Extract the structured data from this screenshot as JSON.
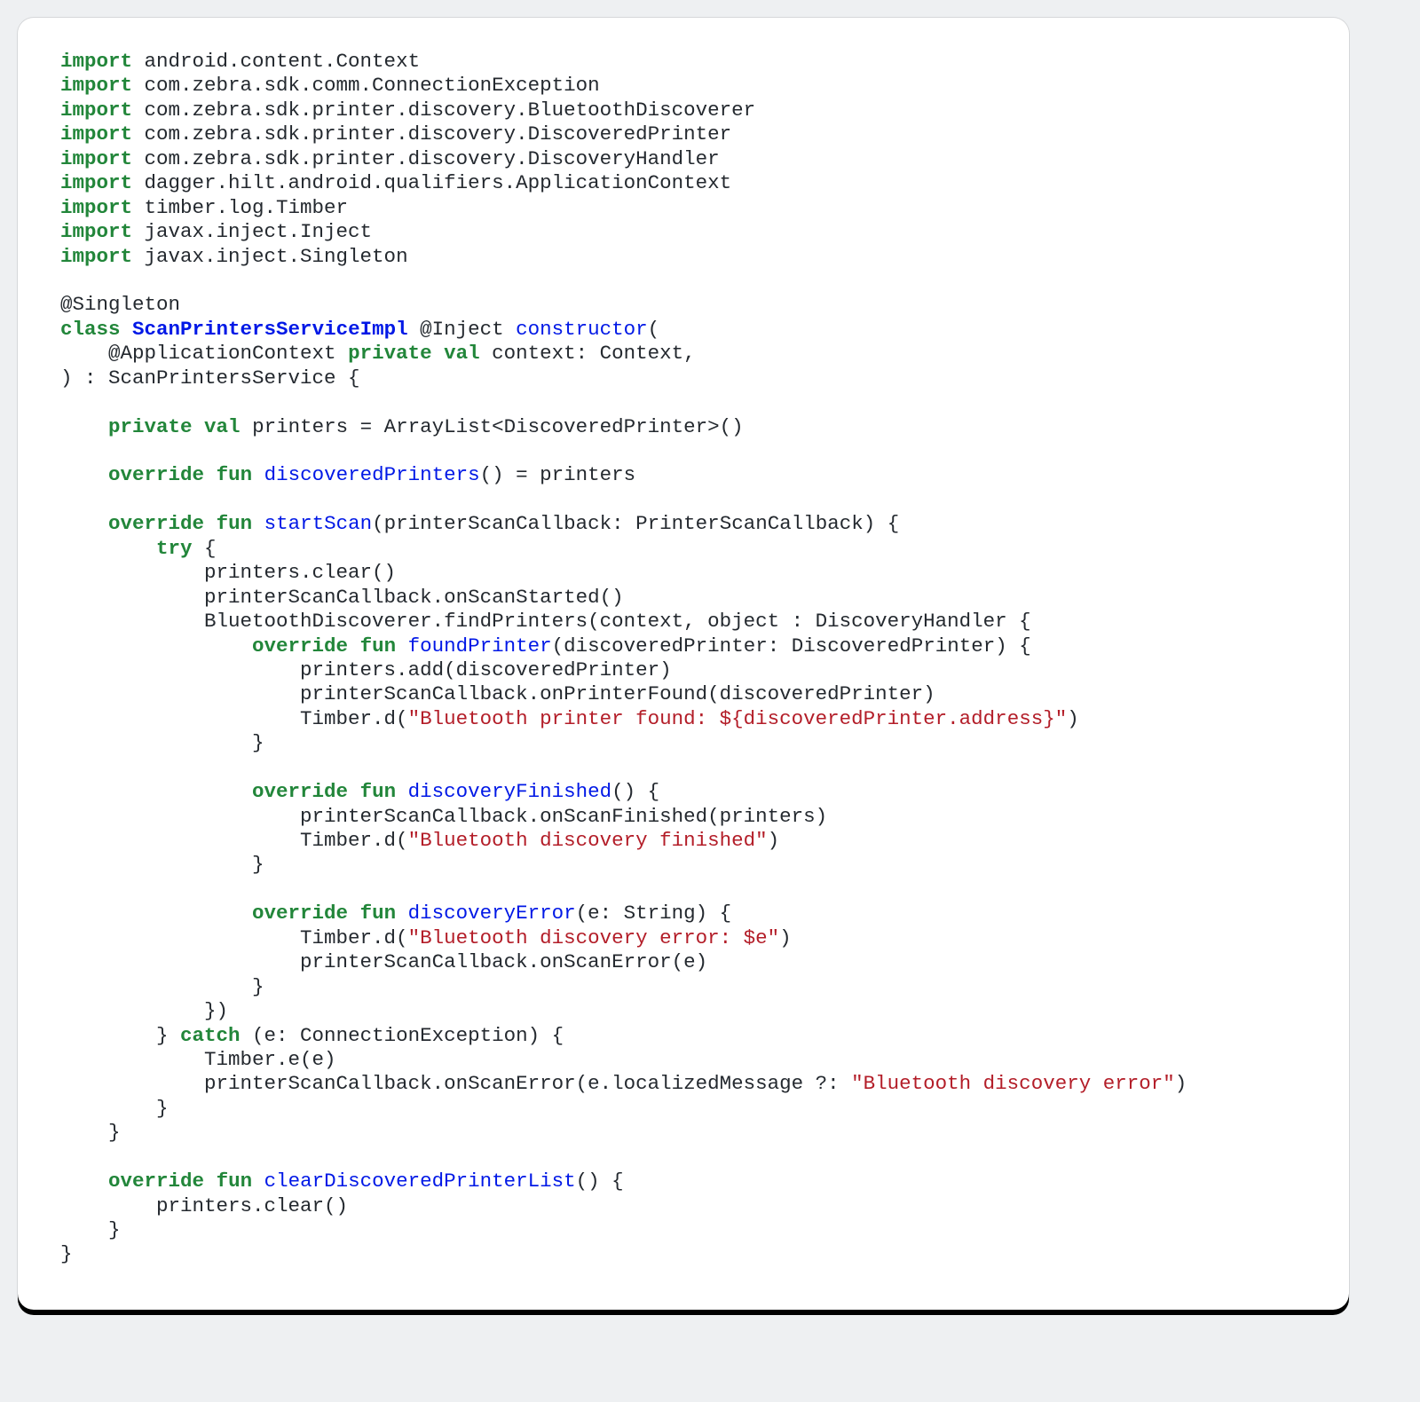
{
  "code": {
    "kw_import": "import",
    "imports": [
      " android.content.Context",
      " com.zebra.sdk.comm.ConnectionException",
      " com.zebra.sdk.printer.discovery.BluetoothDiscoverer",
      " com.zebra.sdk.printer.discovery.DiscoveredPrinter",
      " com.zebra.sdk.printer.discovery.DiscoveryHandler",
      " dagger.hilt.android.qualifiers.ApplicationContext",
      " timber.log.Timber",
      " javax.inject.Inject",
      " javax.inject.Singleton"
    ],
    "annotation_singleton": "@Singleton",
    "kw_class": "class",
    "class_name": "ScanPrintersServiceImpl",
    "after_class": " @Inject ",
    "fn_constructor": "constructor",
    "constructor_open": "(",
    "ctor_param_line_prefix": "    @ApplicationContext ",
    "kw_private": "private",
    "kw_val": "val",
    "ctor_param_rest": " context: Context,",
    "ctor_close_line": ") : ScanPrintersService {",
    "printers_decl_prefix": "    ",
    "printers_decl_mid": " printers = ArrayList<DiscoveredPrinter>()",
    "kw_override": "override",
    "kw_fun": "fun",
    "fn_discoveredPrinters": "discoveredPrinters",
    "discoveredPrinters_rest": "() = printers",
    "fn_startScan": "startScan",
    "startScan_sig_rest": "(printerScanCallback: PrinterScanCallback) {",
    "kw_try": "try",
    "try_open": " {",
    "line_clear": "            printers.clear()",
    "line_onScanStarted": "            printerScanCallback.onScanStarted()",
    "line_findPrinters": "            BluetoothDiscoverer.findPrinters(context, object : DiscoveryHandler {",
    "fn_foundPrinter": "foundPrinter",
    "foundPrinter_sig_rest": "(discoveredPrinter: DiscoveredPrinter) {",
    "line_add": "                    printers.add(discoveredPrinter)",
    "line_onPrinterFound": "                    printerScanCallback.onPrinterFound(discoveredPrinter)",
    "timber_d_open": "                    Timber.d(",
    "str_found": "\"Bluetooth printer found: ${discoveredPrinter.address}\"",
    "close_paren": ")",
    "brace_close_16": "                }",
    "fn_discoveryFinished": "discoveryFinished",
    "discoveryFinished_sig_rest": "() {",
    "line_onScanFinished": "                    printerScanCallback.onScanFinished(printers)",
    "str_discovery_finished": "\"Bluetooth discovery finished\"",
    "fn_discoveryError": "discoveryError",
    "discoveryError_sig_rest": "(e: String) {",
    "str_discovery_error_e": "\"Bluetooth discovery error: $e\"",
    "line_onScanError_e": "                    printerScanCallback.onScanError(e)",
    "line_close_anon": "            })",
    "catch_prefix": "        } ",
    "kw_catch": "catch",
    "catch_rest": " (e: ConnectionException) {",
    "line_timber_e": "            Timber.e(e)",
    "line_onScanError_localized_prefix": "            printerScanCallback.onScanError(e.localizedMessage ?: ",
    "str_discovery_error": "\"Bluetooth discovery error\"",
    "brace_close_8": "        }",
    "brace_close_4": "    }",
    "fn_clearDiscoveredPrinterList": "clearDiscoveredPrinterList",
    "clearList_sig_rest": "() {",
    "line_clear2": "        printers.clear()",
    "brace_close_0": "}",
    "indent4": "    ",
    "indent8": "        ",
    "indent16": "                ",
    "space": " "
  }
}
